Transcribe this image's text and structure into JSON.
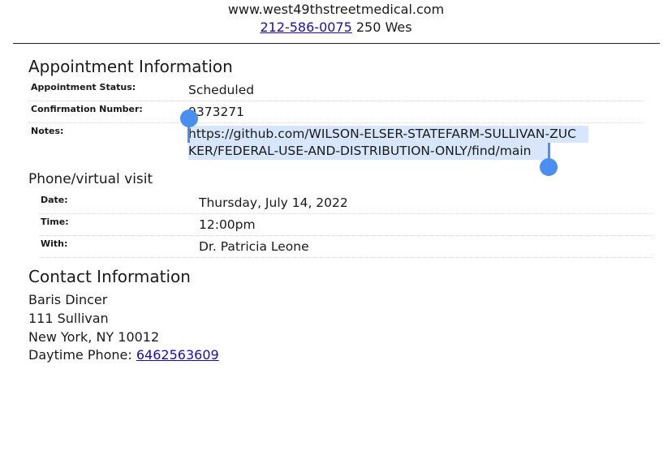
{
  "header": {
    "website": "www.west49thstreetmedical.com",
    "phone": "212-586-0075",
    "address_fragment": "250 Wes"
  },
  "appointment": {
    "title": "Appointment Information",
    "status_label": "Appointment Status:",
    "status_value": "Scheduled",
    "confirmation_label": "Confirmation Number:",
    "confirmation_value": "9373271",
    "notes_label": "Notes:",
    "notes_value": "https://github.com/WILSON-ELSER-STATEFARM-SULLIVAN-ZUCKER/FEDERAL-USE-AND-DISTRIBUTION-ONLY/find/main"
  },
  "visit": {
    "title": "Phone/virtual visit",
    "date_label": "Date:",
    "date_value": "Thursday, July 14, 2022",
    "time_label": "Time:",
    "time_value": "12:00pm",
    "with_label": "With:",
    "with_value": "Dr. Patricia Leone"
  },
  "contact": {
    "title": "Contact Information",
    "name": "Baris Dincer",
    "street": "111 Sullivan",
    "city": "New York, NY 10012",
    "phone_label": "Daytime Phone:",
    "phone_value": "6462563609"
  },
  "colors": {
    "link": "#1a0dab",
    "selection_highlight": "#d7e6fa",
    "selection_handle": "#4a8ef0"
  }
}
